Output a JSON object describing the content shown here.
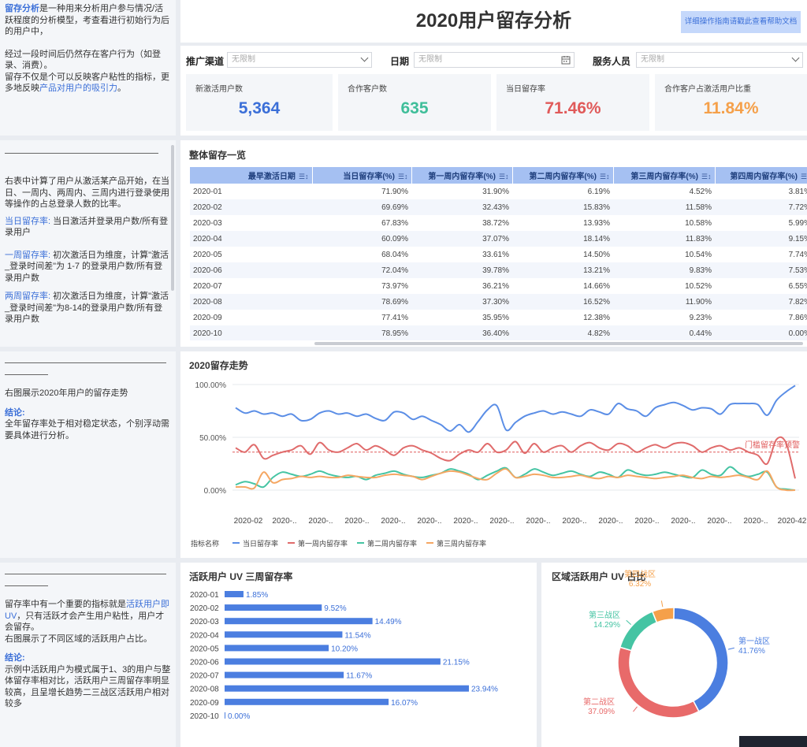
{
  "title": "2020用户留存分析",
  "help_button": "详细操作指南请戳此查看帮助文档",
  "intro": {
    "term": "留存分析",
    "text1": "是一种用来分析用户参与情况/活跃程度的分析模型，考查看进行初始行为后的用户中，",
    "text2": "经过一段时间后仍然存在客户行为（如登录、消费）。",
    "text3a": "留存不仅是个可以反映客户粘性的指标，更多地反映",
    "text3b": "产品对用户的吸引力",
    "text3c": "。"
  },
  "filters": {
    "channel_label": "推广渠道",
    "channel_value": "无限制",
    "date_label": "日期",
    "date_value": "无限制",
    "staff_label": "服务人员",
    "staff_value": "无限制"
  },
  "kpis": [
    {
      "label": "新激活用户数",
      "value": "5,364",
      "color": "#3b6fd8"
    },
    {
      "label": "合作客户数",
      "value": "635",
      "color": "#3fbe9a"
    },
    {
      "label": "当日留存率",
      "value": "71.46%",
      "color": "#e05a5a"
    },
    {
      "label": "合作客户占激活用户比重",
      "value": "11.84%",
      "color": "#f5a04a"
    }
  ],
  "desc2": {
    "p1": "右表中计算了用户从激活某产品开始，在当日、一周内、两周内、三周内进行登录使用等操作的占总登录人数的比率。",
    "d1_term": "当日留存率:",
    "d1_text": " 当日激活并登录用户数/所有登录用户",
    "d2_term": "一周留存率:",
    "d2_text": " 初次激活日为维度，计算\"激活_登录时间差\"为 1-7 的登录用户数/所有登录用户数",
    "d3_term": "两周留存率:",
    "d3_text": " 初次激活日为维度，计算\"激活_登录时间差\"为8-14的登录用户数/所有登录用户数"
  },
  "table": {
    "title": "整体留存一览",
    "headers": [
      "最早激活日期",
      "当日留存率(%)",
      "第一周内留存率(%)",
      "第二周内留存率(%)",
      "第三周内留存率(%)",
      "第四周内留存率(%)"
    ],
    "rows": [
      [
        "2020-01",
        "71.90%",
        "31.90%",
        "6.19%",
        "4.52%",
        "3.81%"
      ],
      [
        "2020-02",
        "69.69%",
        "32.43%",
        "15.83%",
        "11.58%",
        "7.72%"
      ],
      [
        "2020-03",
        "67.83%",
        "38.72%",
        "13.93%",
        "10.58%",
        "5.99%"
      ],
      [
        "2020-04",
        "60.09%",
        "37.07%",
        "18.14%",
        "11.83%",
        "9.15%"
      ],
      [
        "2020-05",
        "68.04%",
        "33.61%",
        "14.50%",
        "10.54%",
        "7.74%"
      ],
      [
        "2020-06",
        "72.04%",
        "39.78%",
        "13.21%",
        "9.83%",
        "7.53%"
      ],
      [
        "2020-07",
        "73.97%",
        "36.21%",
        "14.66%",
        "10.52%",
        "6.55%"
      ],
      [
        "2020-08",
        "78.69%",
        "37.30%",
        "16.52%",
        "11.90%",
        "7.82%"
      ],
      [
        "2020-09",
        "77.41%",
        "35.95%",
        "12.38%",
        "9.23%",
        "7.86%"
      ],
      [
        "2020-10",
        "78.95%",
        "36.40%",
        "4.82%",
        "0.44%",
        "0.00%"
      ]
    ]
  },
  "desc3": {
    "p1": "右图展示2020年用户的留存走势",
    "conc_label": "结论:",
    "conc_text": "全年留存率处于相对稳定状态，个别浮动需要具体进行分析。"
  },
  "desc4": {
    "p1a": "留存率中有一个重要的指标就是",
    "p1b": "活跃用户即UV",
    "p1c": "，只有活跃才会产生用户粘性，用户才会留存。",
    "p2": "右图展示了不同区域的活跃用户占比。",
    "conc_label": "结论:",
    "conc_text": "示例中活跃用户为模式属于1、3的用户与整体留存率相对比，活跃用户三周留存率明显较高，且呈增长趋势二三战区活跃用户相对较多"
  },
  "chart_data": [
    {
      "type": "line",
      "title": "2020留存走势",
      "y_ticks": [
        "100.00%",
        "50.00%",
        "0.00%"
      ],
      "ylim": [
        0,
        100
      ],
      "x_tick_labels": [
        "2020-02",
        "2020-..",
        "2020-..",
        "2020-..",
        "2020-..",
        "2020-..",
        "2020-..",
        "2020-..",
        "2020-..",
        "2020-..",
        "2020-..",
        "2020-..",
        "2020-..",
        "2020-..",
        "2020-..",
        "2020-42"
      ],
      "legend_title": "指标名称",
      "legend_position": "bottom-left",
      "threshold": {
        "value": 36,
        "label": "门槛留存率预警",
        "color": "#e05a5a"
      },
      "series": [
        {
          "name": "当日留存率",
          "color": "#5b8ee6",
          "values": [
            78,
            73,
            75,
            72,
            73,
            70,
            72,
            66,
            67,
            73,
            75,
            72,
            73,
            70,
            72,
            68,
            66,
            74,
            73,
            67,
            70,
            66,
            62,
            56,
            62,
            55,
            65,
            76,
            80,
            57,
            64,
            70,
            73,
            75,
            72,
            74,
            72,
            70,
            76,
            74,
            72,
            82,
            77,
            75,
            70,
            78,
            81,
            83,
            80,
            76,
            78,
            77,
            72,
            81,
            82,
            82,
            81,
            71,
            85,
            93,
            99
          ]
        },
        {
          "name": "第一周内留存率",
          "color": "#e06b6b",
          "values": [
            40,
            36,
            43,
            30,
            33,
            36,
            38,
            42,
            34,
            45,
            38,
            36,
            40,
            44,
            38,
            42,
            38,
            33,
            40,
            42,
            38,
            35,
            30,
            28,
            34,
            38,
            36,
            44,
            36,
            38,
            46,
            35,
            44,
            36,
            40,
            42,
            36,
            42,
            45,
            40,
            38,
            44,
            42,
            36,
            40,
            43,
            40,
            44,
            45,
            42,
            36,
            40,
            42,
            38,
            40,
            36,
            33,
            25,
            48,
            45,
            11
          ]
        },
        {
          "name": "第二周内留存率",
          "color": "#45c4a3",
          "values": [
            5,
            8,
            6,
            3,
            12,
            17,
            15,
            13,
            15,
            18,
            15,
            13,
            12,
            13,
            10,
            14,
            16,
            18,
            15,
            13,
            12,
            14,
            16,
            20,
            18,
            15,
            10,
            14,
            18,
            21,
            12,
            15,
            20,
            17,
            14,
            16,
            18,
            15,
            13,
            17,
            15,
            12,
            19,
            16,
            14,
            15,
            17,
            15,
            13,
            12,
            19,
            15,
            14,
            22,
            16,
            13,
            15,
            17,
            3,
            1,
            0
          ]
        },
        {
          "name": "第三周内留存率",
          "color": "#f5a763",
          "values": [
            3,
            3,
            2,
            17,
            7,
            10,
            11,
            13,
            12,
            13,
            12,
            12,
            14,
            13,
            12,
            12,
            14,
            15,
            14,
            13,
            10,
            13,
            16,
            18,
            17,
            14,
            11,
            10,
            16,
            20,
            12,
            13,
            15,
            14,
            12,
            12,
            13,
            14,
            12,
            11,
            13,
            12,
            14,
            13,
            12,
            11,
            12,
            13,
            14,
            12,
            11,
            13,
            12,
            13,
            14,
            12,
            10,
            18,
            3,
            0,
            0
          ]
        }
      ]
    },
    {
      "type": "bar",
      "title": "活跃用户 UV 三周留存率",
      "orientation": "horizontal",
      "categories": [
        "2020-01",
        "2020-02",
        "2020-03",
        "2020-04",
        "2020-05",
        "2020-06",
        "2020-07",
        "2020-08",
        "2020-09",
        "2020-10"
      ],
      "values": [
        1.85,
        9.52,
        14.49,
        11.54,
        10.2,
        21.15,
        11.67,
        23.94,
        16.07,
        0.0
      ],
      "labels": [
        "1.85%",
        "9.52%",
        "14.49%",
        "11.54%",
        "10.20%",
        "21.15%",
        "11.67%",
        "23.94%",
        "16.07%",
        "0.00%"
      ],
      "color": "#4b7ee0"
    },
    {
      "type": "pie",
      "title": "区域活跃用户 UV 占比",
      "donut": true,
      "slices": [
        {
          "name": "第一战区",
          "value": 41.76,
          "label": "41.76%",
          "color": "#4b7ee0"
        },
        {
          "name": "第二战区",
          "value": 37.09,
          "label": "37.09%",
          "color": "#e86a6a"
        },
        {
          "name": "第三战区",
          "value": 14.29,
          "label": "14.29%",
          "color": "#45c4a3"
        },
        {
          "name": "第四战区",
          "value": 6.32,
          "label": "6.32%",
          "color": "#f5a04a"
        }
      ]
    }
  ]
}
